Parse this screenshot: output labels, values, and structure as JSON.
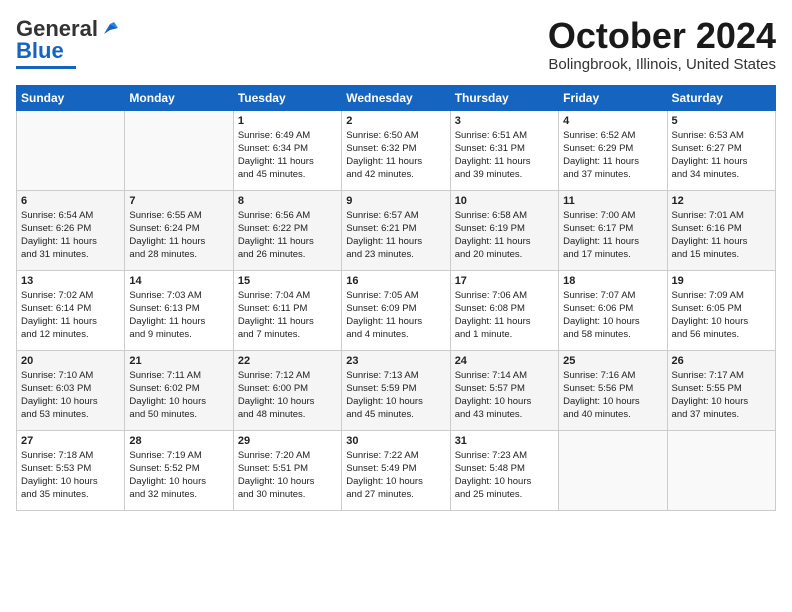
{
  "header": {
    "logo_general": "General",
    "logo_blue": "Blue",
    "month": "October 2024",
    "location": "Bolingbrook, Illinois, United States"
  },
  "days_of_week": [
    "Sunday",
    "Monday",
    "Tuesday",
    "Wednesday",
    "Thursday",
    "Friday",
    "Saturday"
  ],
  "weeks": [
    [
      {
        "num": "",
        "info": ""
      },
      {
        "num": "",
        "info": ""
      },
      {
        "num": "1",
        "info": "Sunrise: 6:49 AM\nSunset: 6:34 PM\nDaylight: 11 hours\nand 45 minutes."
      },
      {
        "num": "2",
        "info": "Sunrise: 6:50 AM\nSunset: 6:32 PM\nDaylight: 11 hours\nand 42 minutes."
      },
      {
        "num": "3",
        "info": "Sunrise: 6:51 AM\nSunset: 6:31 PM\nDaylight: 11 hours\nand 39 minutes."
      },
      {
        "num": "4",
        "info": "Sunrise: 6:52 AM\nSunset: 6:29 PM\nDaylight: 11 hours\nand 37 minutes."
      },
      {
        "num": "5",
        "info": "Sunrise: 6:53 AM\nSunset: 6:27 PM\nDaylight: 11 hours\nand 34 minutes."
      }
    ],
    [
      {
        "num": "6",
        "info": "Sunrise: 6:54 AM\nSunset: 6:26 PM\nDaylight: 11 hours\nand 31 minutes."
      },
      {
        "num": "7",
        "info": "Sunrise: 6:55 AM\nSunset: 6:24 PM\nDaylight: 11 hours\nand 28 minutes."
      },
      {
        "num": "8",
        "info": "Sunrise: 6:56 AM\nSunset: 6:22 PM\nDaylight: 11 hours\nand 26 minutes."
      },
      {
        "num": "9",
        "info": "Sunrise: 6:57 AM\nSunset: 6:21 PM\nDaylight: 11 hours\nand 23 minutes."
      },
      {
        "num": "10",
        "info": "Sunrise: 6:58 AM\nSunset: 6:19 PM\nDaylight: 11 hours\nand 20 minutes."
      },
      {
        "num": "11",
        "info": "Sunrise: 7:00 AM\nSunset: 6:17 PM\nDaylight: 11 hours\nand 17 minutes."
      },
      {
        "num": "12",
        "info": "Sunrise: 7:01 AM\nSunset: 6:16 PM\nDaylight: 11 hours\nand 15 minutes."
      }
    ],
    [
      {
        "num": "13",
        "info": "Sunrise: 7:02 AM\nSunset: 6:14 PM\nDaylight: 11 hours\nand 12 minutes."
      },
      {
        "num": "14",
        "info": "Sunrise: 7:03 AM\nSunset: 6:13 PM\nDaylight: 11 hours\nand 9 minutes."
      },
      {
        "num": "15",
        "info": "Sunrise: 7:04 AM\nSunset: 6:11 PM\nDaylight: 11 hours\nand 7 minutes."
      },
      {
        "num": "16",
        "info": "Sunrise: 7:05 AM\nSunset: 6:09 PM\nDaylight: 11 hours\nand 4 minutes."
      },
      {
        "num": "17",
        "info": "Sunrise: 7:06 AM\nSunset: 6:08 PM\nDaylight: 11 hours\nand 1 minute."
      },
      {
        "num": "18",
        "info": "Sunrise: 7:07 AM\nSunset: 6:06 PM\nDaylight: 10 hours\nand 58 minutes."
      },
      {
        "num": "19",
        "info": "Sunrise: 7:09 AM\nSunset: 6:05 PM\nDaylight: 10 hours\nand 56 minutes."
      }
    ],
    [
      {
        "num": "20",
        "info": "Sunrise: 7:10 AM\nSunset: 6:03 PM\nDaylight: 10 hours\nand 53 minutes."
      },
      {
        "num": "21",
        "info": "Sunrise: 7:11 AM\nSunset: 6:02 PM\nDaylight: 10 hours\nand 50 minutes."
      },
      {
        "num": "22",
        "info": "Sunrise: 7:12 AM\nSunset: 6:00 PM\nDaylight: 10 hours\nand 48 minutes."
      },
      {
        "num": "23",
        "info": "Sunrise: 7:13 AM\nSunset: 5:59 PM\nDaylight: 10 hours\nand 45 minutes."
      },
      {
        "num": "24",
        "info": "Sunrise: 7:14 AM\nSunset: 5:57 PM\nDaylight: 10 hours\nand 43 minutes."
      },
      {
        "num": "25",
        "info": "Sunrise: 7:16 AM\nSunset: 5:56 PM\nDaylight: 10 hours\nand 40 minutes."
      },
      {
        "num": "26",
        "info": "Sunrise: 7:17 AM\nSunset: 5:55 PM\nDaylight: 10 hours\nand 37 minutes."
      }
    ],
    [
      {
        "num": "27",
        "info": "Sunrise: 7:18 AM\nSunset: 5:53 PM\nDaylight: 10 hours\nand 35 minutes."
      },
      {
        "num": "28",
        "info": "Sunrise: 7:19 AM\nSunset: 5:52 PM\nDaylight: 10 hours\nand 32 minutes."
      },
      {
        "num": "29",
        "info": "Sunrise: 7:20 AM\nSunset: 5:51 PM\nDaylight: 10 hours\nand 30 minutes."
      },
      {
        "num": "30",
        "info": "Sunrise: 7:22 AM\nSunset: 5:49 PM\nDaylight: 10 hours\nand 27 minutes."
      },
      {
        "num": "31",
        "info": "Sunrise: 7:23 AM\nSunset: 5:48 PM\nDaylight: 10 hours\nand 25 minutes."
      },
      {
        "num": "",
        "info": ""
      },
      {
        "num": "",
        "info": ""
      }
    ]
  ]
}
